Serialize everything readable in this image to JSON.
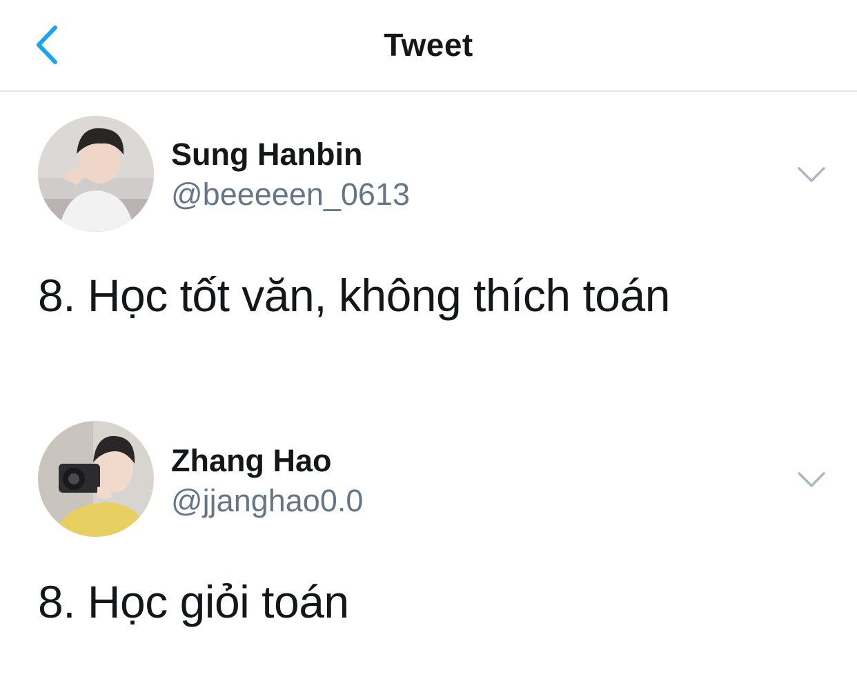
{
  "header": {
    "title": "Tweet",
    "back_icon": "chevron-left-icon",
    "accent_color": "#1da1f2"
  },
  "tweets": [
    {
      "display_name": "Sung Hanbin",
      "handle": "@beeeeen_0613",
      "text": "8. Học tốt văn, không thích toán",
      "menu_icon": "chevron-down-icon"
    },
    {
      "display_name": "Zhang Hao",
      "handle": "@jjanghao0.0",
      "text": "8. Học giỏi toán",
      "menu_icon": "chevron-down-icon"
    }
  ],
  "colors": {
    "text_primary": "#14171a",
    "text_secondary": "#657786",
    "divider": "#e1e5e9",
    "chevron": "#aab8c2"
  }
}
